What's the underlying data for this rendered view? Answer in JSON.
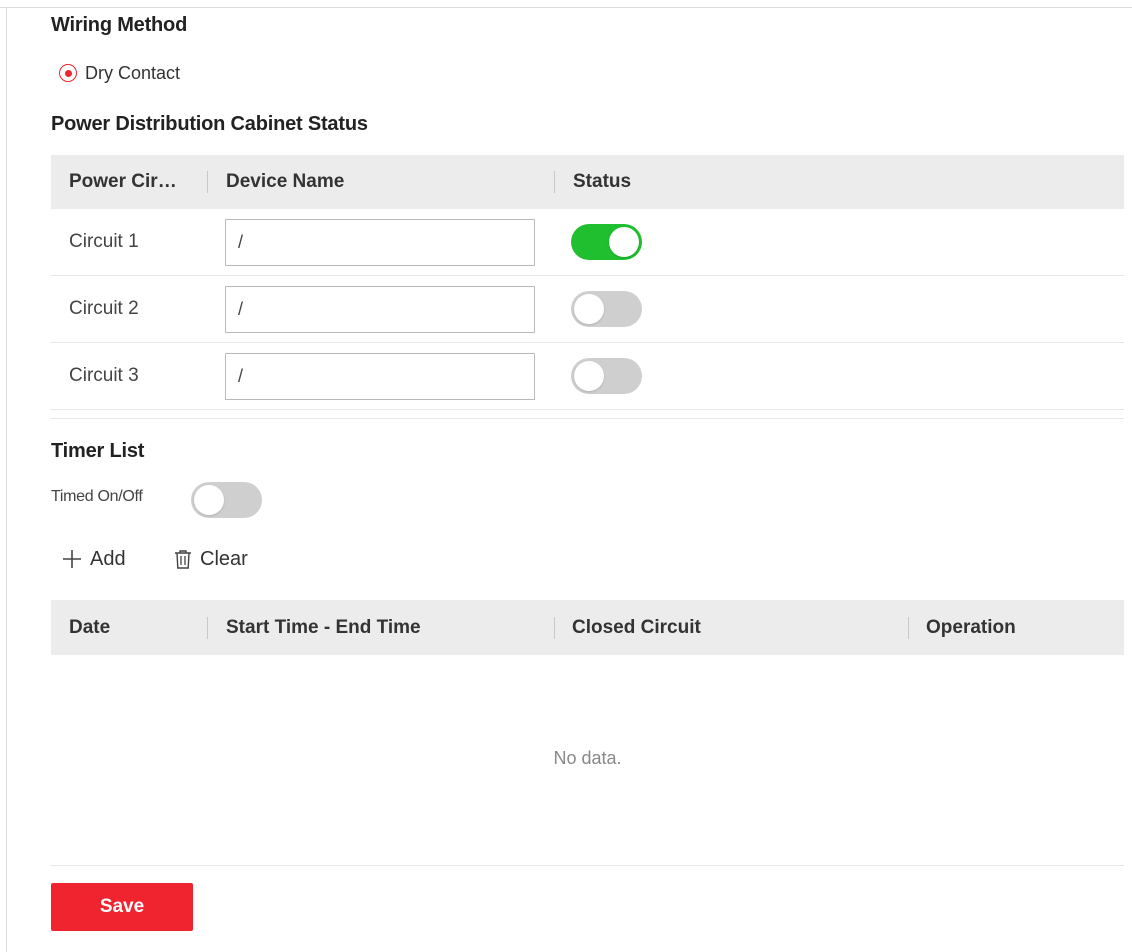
{
  "wiring": {
    "title": "Wiring Method",
    "option_label": "Dry Contact"
  },
  "cabinet": {
    "title": "Power Distribution Cabinet Status",
    "headers": {
      "circuit": "Power Cir…",
      "device_name": "Device Name",
      "status": "Status"
    },
    "rows": [
      {
        "circuit": "Circuit 1",
        "device_name": "/",
        "status_on": true
      },
      {
        "circuit": "Circuit 2",
        "device_name": "/",
        "status_on": false
      },
      {
        "circuit": "Circuit 3",
        "device_name": "/",
        "status_on": false
      }
    ]
  },
  "timer": {
    "title": "Timer List",
    "timed_label": "Timed On/Off",
    "timed_on": false,
    "add_label": "Add",
    "clear_label": "Clear",
    "headers": {
      "date": "Date",
      "time_range": "Start Time - End Time",
      "closed_circuit": "Closed Circuit",
      "operation": "Operation"
    },
    "empty_text": "No data."
  },
  "save_label": "Save",
  "colors": {
    "accent_red": "#f0242f",
    "toggle_on": "#1fbf2f",
    "toggle_off": "#cfcfcf",
    "header_bg": "#ececec"
  },
  "icons": {
    "add": "plus-icon",
    "clear": "trash-icon"
  }
}
